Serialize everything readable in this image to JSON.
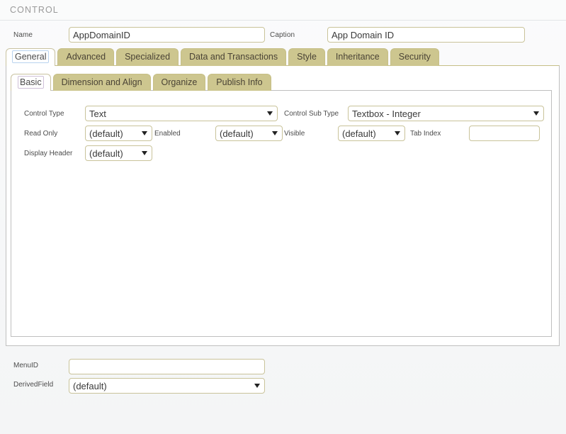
{
  "header": {
    "title": "CONTROL"
  },
  "top_fields": {
    "name_label": "Name",
    "name_value": "AppDomainID",
    "caption_label": "Caption",
    "caption_value": "App Domain ID"
  },
  "main_tabs": [
    {
      "label": "General",
      "active": true
    },
    {
      "label": "Advanced",
      "active": false
    },
    {
      "label": "Specialized",
      "active": false
    },
    {
      "label": "Data and Transactions",
      "active": false
    },
    {
      "label": "Style",
      "active": false
    },
    {
      "label": "Inheritance",
      "active": false
    },
    {
      "label": "Security",
      "active": false
    }
  ],
  "sub_tabs": [
    {
      "label": "Basic",
      "active": true
    },
    {
      "label": "Dimension and Align",
      "active": false
    },
    {
      "label": "Organize",
      "active": false
    },
    {
      "label": "Publish Info",
      "active": false
    }
  ],
  "form": {
    "control_type_label": "Control Type",
    "control_type_value": "Text",
    "control_type_options": [
      "Text"
    ],
    "control_sub_type_label": "Control Sub Type",
    "control_sub_type_value": "Textbox - Integer",
    "control_sub_type_options": [
      "Textbox - Integer"
    ],
    "read_only_label": "Read Only",
    "read_only_value": "(default)",
    "read_only_options": [
      "(default)"
    ],
    "enabled_label": "Enabled",
    "enabled_value": "(default)",
    "enabled_options": [
      "(default)"
    ],
    "visible_label": "Visible",
    "visible_value": "(default)",
    "visible_options": [
      "(default)"
    ],
    "tab_index_label": "Tab Index",
    "tab_index_value": "",
    "display_header_label": "Display Header",
    "display_header_value": "(default)",
    "display_header_options": [
      "(default)"
    ]
  },
  "bottom": {
    "menu_id_label": "MenuID",
    "menu_id_value": "",
    "derived_field_label": "DerivedField",
    "derived_field_value": "(default)",
    "derived_field_options": [
      "(default)"
    ]
  },
  "colors": {
    "tab_khaki": "#cdc68f",
    "field_border": "#c9c39a",
    "panel_border": "#bfbfbf",
    "header_text": "#9a9a9a",
    "page_bg": "#f7f8f9"
  }
}
